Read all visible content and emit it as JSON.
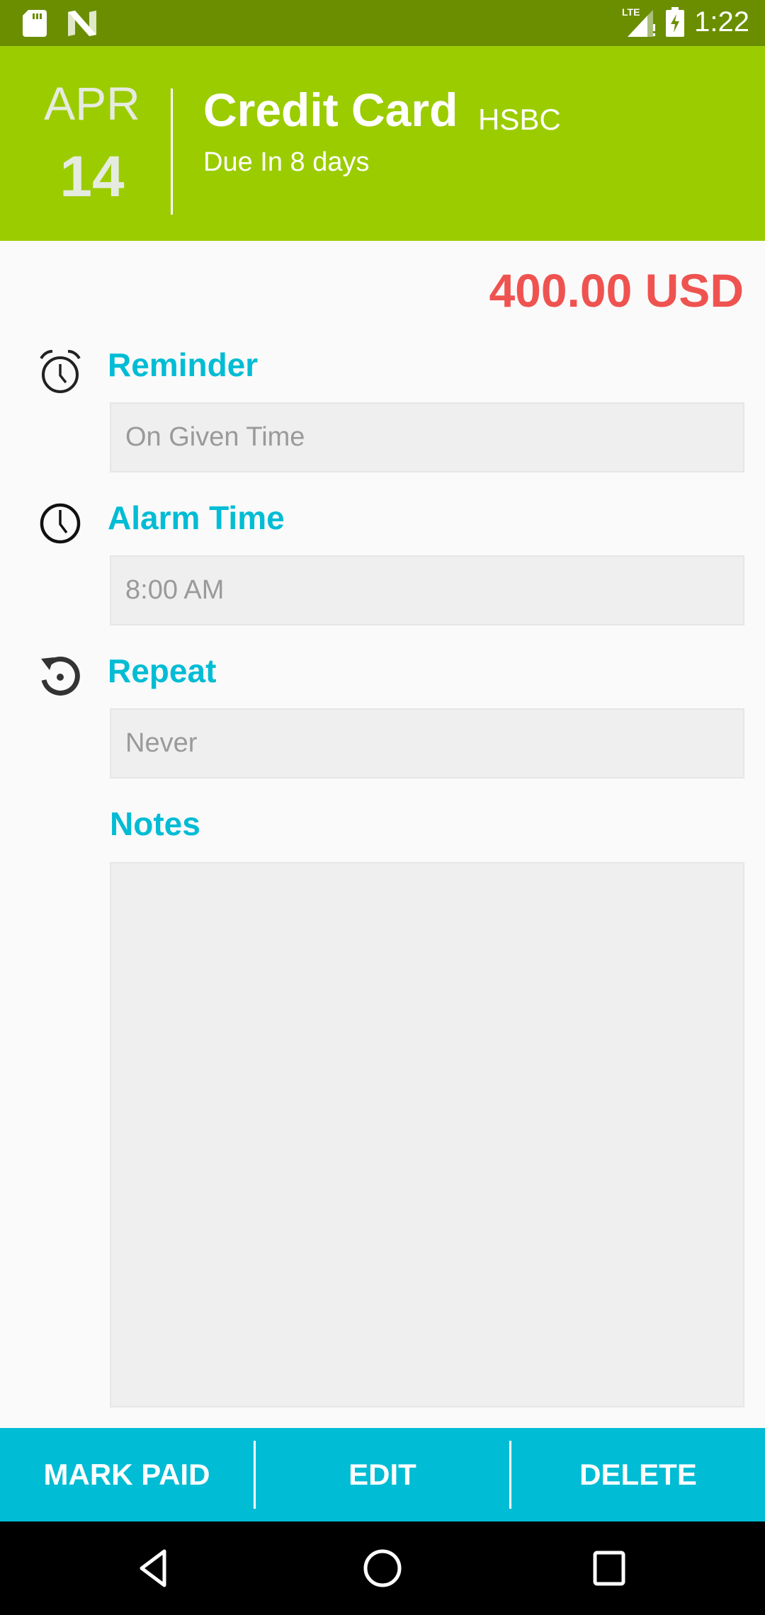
{
  "status_bar": {
    "left_icons": [
      "sd-card-icon",
      "n-notification-icon"
    ],
    "network": "LTE",
    "time": "1:22"
  },
  "header": {
    "month": "APR",
    "day": "14",
    "title": "Credit Card",
    "payee": "HSBC",
    "due": "Due In 8 days",
    "background_color": "#9bcc00"
  },
  "amount": "400.00 USD",
  "amount_color": "#ef5350",
  "fields": {
    "reminder": {
      "label": "Reminder",
      "value": "On Given Time",
      "icon": "alarm-clock-icon"
    },
    "alarm_time": {
      "label": "Alarm Time",
      "value": "8:00 AM",
      "icon": "clock-icon"
    },
    "repeat": {
      "label": "Repeat",
      "value": "Never",
      "icon": "repeat-icon"
    },
    "notes": {
      "label": "Notes",
      "value": ""
    }
  },
  "actions": {
    "mark_paid": "MARK PAID",
    "edit": "EDIT",
    "delete": "DELETE",
    "background_color": "#00bcd4"
  },
  "nav": [
    "back-icon",
    "home-icon",
    "recents-icon"
  ]
}
